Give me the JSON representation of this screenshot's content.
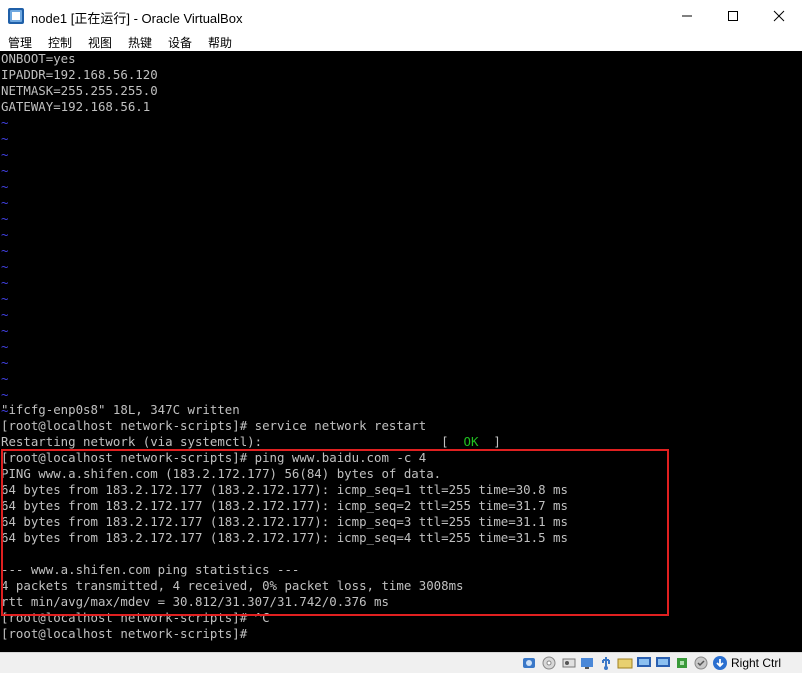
{
  "window": {
    "title": "node1 [正在运行] - Oracle VirtualBox"
  },
  "menu": [
    {
      "label": "管理"
    },
    {
      "label": "控制"
    },
    {
      "label": "视图"
    },
    {
      "label": "热键"
    },
    {
      "label": "设备"
    },
    {
      "label": "帮助"
    }
  ],
  "terminal": {
    "file_lines": [
      "ONBOOT=yes",
      "IPADDR=192.168.56.120",
      "NETMASK=255.255.255.0",
      "GATEWAY=192.168.56.1"
    ],
    "tilde": "~",
    "tilde_count": 19,
    "written": "\"ifcfg-enp0s8\" 18L, 347C written",
    "restart_cmd": "[root@localhost network-scripts]# service network restart",
    "restarting": "Restarting network (via systemctl):                        [  ",
    "ok": "OK",
    "ok_close": "  ]",
    "ping_cmd": "[root@localhost network-scripts]# ping www.baidu.com -c 4",
    "ping_lines": [
      "PING www.a.shifen.com (183.2.172.177) 56(84) bytes of data.",
      "64 bytes from 183.2.172.177 (183.2.172.177): icmp_seq=1 ttl=255 time=30.8 ms",
      "64 bytes from 183.2.172.177 (183.2.172.177): icmp_seq=2 ttl=255 time=31.7 ms",
      "64 bytes from 183.2.172.177 (183.2.172.177): icmp_seq=3 ttl=255 time=31.1 ms",
      "64 bytes from 183.2.172.177 (183.2.172.177): icmp_seq=4 ttl=255 time=31.5 ms"
    ],
    "stats_header": "--- www.a.shifen.com ping statistics ---",
    "stats_packets": "4 packets transmitted, 4 received, 0% packet loss, time 3008ms",
    "stats_rtt": "rtt min/avg/max/mdev = 30.812/31.307/31.742/0.376 ms",
    "interrupt_line": "[root@localhost network-scripts]# ^C",
    "prompt_line": "[root@localhost network-scripts]# "
  },
  "statusbar": {
    "host_key": "Right Ctrl"
  },
  "colors": {
    "highlight": "#e02020",
    "tilde": "#4040e0",
    "ok": "#20c020"
  }
}
